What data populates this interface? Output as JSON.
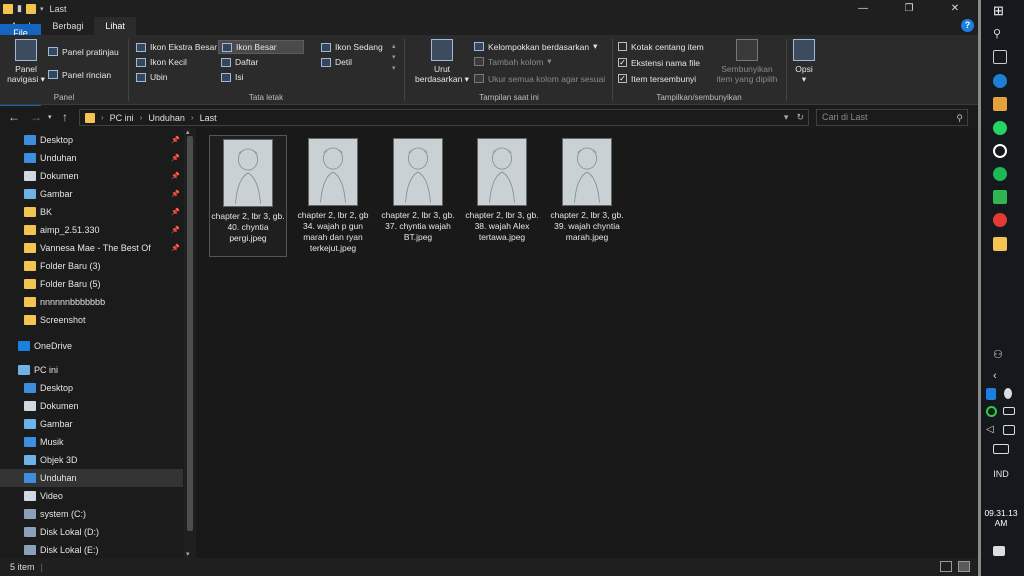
{
  "window": {
    "title": "Last"
  },
  "tabs": [
    "File",
    "Awal",
    "Berbagi",
    "Lihat"
  ],
  "ribbon": {
    "panel": {
      "nav_label": "Panel navigasi",
      "preview_label": "Panel pratinjau",
      "details_label": "Panel rincian",
      "group_label": "Panel"
    },
    "layout": {
      "items": [
        "Ikon Ekstra Besar",
        "Ikon Besar",
        "Ikon Sedang",
        "Ikon Kecil",
        "Daftar",
        "Detil",
        "Ubin",
        "Isi"
      ],
      "selected": "Ikon Besar",
      "group_label": "Tata letak"
    },
    "current_view": {
      "sort_label": "Urut berdasarkan",
      "group_by_label": "Kelompokkan berdasarkan",
      "add_column_label": "Tambah kolom",
      "fit_columns_label": "Ukur semua kolom agar sesuai",
      "group_label": "Tampilan saat ini"
    },
    "show_hide": {
      "checkboxes": [
        {
          "label": "Kotak centang item",
          "checked": false
        },
        {
          "label": "Ekstensi nama file",
          "checked": true
        },
        {
          "label": "Item tersembunyi",
          "checked": true
        }
      ],
      "hide_selected_label": "Sembunyikan item yang dipilih",
      "options_label": "Opsi",
      "group_label": "Tampilkan/sembunyikan"
    }
  },
  "address": {
    "crumbs": [
      "PC ini",
      "Unduhan",
      "Last"
    ],
    "search_placeholder": "Cari di Last"
  },
  "sidebar": {
    "quick_access": [
      {
        "label": "Desktop",
        "icon": "desktop-icon",
        "pinned": true
      },
      {
        "label": "Unduhan",
        "icon": "download-icon",
        "pinned": true
      },
      {
        "label": "Dokumen",
        "icon": "documents-icon",
        "pinned": true
      },
      {
        "label": "Gambar",
        "icon": "pictures-icon",
        "pinned": true
      },
      {
        "label": "BK",
        "icon": "folder-icon",
        "pinned": true
      },
      {
        "label": "aimp_2.51.330",
        "icon": "folder-icon",
        "pinned": true
      },
      {
        "label": "Vannesa Mae - The Best Of",
        "icon": "folder-icon",
        "pinned": true
      },
      {
        "label": "Folder Baru (3)",
        "icon": "folder-icon",
        "pinned": false
      },
      {
        "label": "Folder Baru (5)",
        "icon": "folder-icon",
        "pinned": false
      },
      {
        "label": "nnnnnnbbbbbbb",
        "icon": "folder-icon",
        "pinned": false
      },
      {
        "label": "Screenshot",
        "icon": "folder-icon",
        "pinned": false
      }
    ],
    "onedrive": "OneDrive",
    "pc": "PC ini",
    "pc_items": [
      {
        "label": "Desktop",
        "icon": "desktop-icon"
      },
      {
        "label": "Dokumen",
        "icon": "documents-icon"
      },
      {
        "label": "Gambar",
        "icon": "pictures-icon"
      },
      {
        "label": "Musik",
        "icon": "music-icon"
      },
      {
        "label": "Objek 3D",
        "icon": "3d-objects-icon"
      },
      {
        "label": "Unduhan",
        "icon": "download-icon",
        "selected": true
      },
      {
        "label": "Video",
        "icon": "video-icon"
      },
      {
        "label": "system (C:)",
        "icon": "drive-icon"
      },
      {
        "label": "Disk Lokal (D:)",
        "icon": "drive-icon"
      },
      {
        "label": "Disk Lokal (E:)",
        "icon": "drive-icon"
      }
    ]
  },
  "files": [
    {
      "name": "chapter 2, lbr 3, gb. 40. chyntia pergi.jpeg",
      "selected": true
    },
    {
      "name": "chapter 2, lbr 2, gb 34. wajah p gun marah dan ryan terkejut.jpeg",
      "selected": false
    },
    {
      "name": "chapter 2, lbr 3, gb. 37. chyntia wajah BT.jpeg",
      "selected": false
    },
    {
      "name": "chapter 2, lbr 3, gb. 38. wajah Alex tertawa.jpeg",
      "selected": false
    },
    {
      "name": "chapter 2, lbr 3, gb. 39. wajah chyntia marah.jpeg",
      "selected": false
    }
  ],
  "status": {
    "item_count": "5 item"
  },
  "taskbar": {
    "language": "IND",
    "time": "09.31.13 AM"
  },
  "colors": {
    "file_tab": "#1565c0",
    "folder": "#f3c44f",
    "accent_blue": "#1b7fe0"
  }
}
